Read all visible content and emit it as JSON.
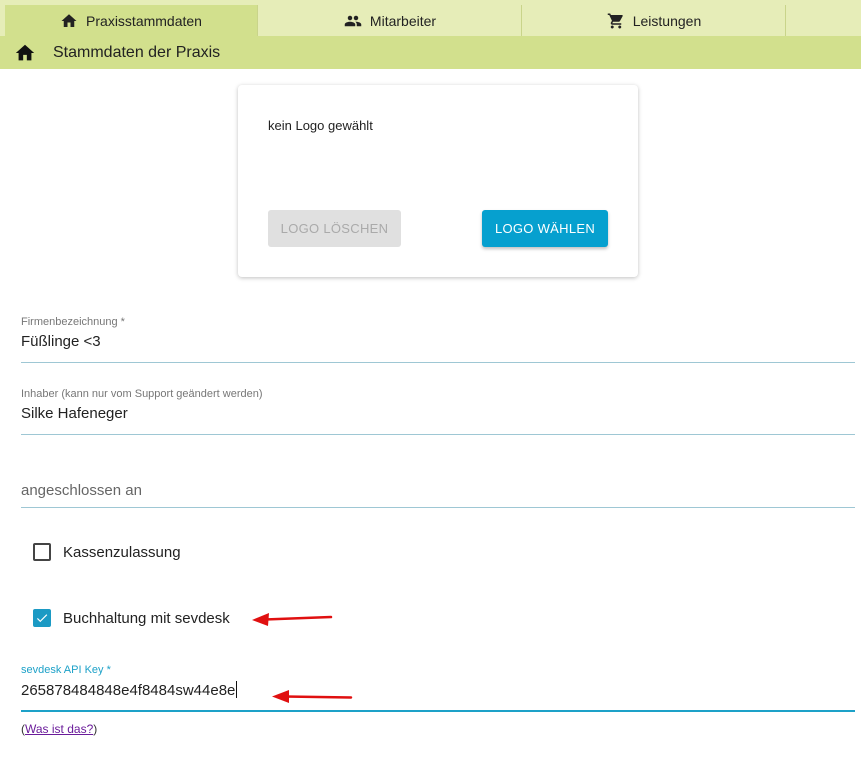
{
  "tabs": [
    {
      "label": "Praxisstammdaten",
      "icon": "home-icon",
      "active": true
    },
    {
      "label": "Mitarbeiter",
      "icon": "people-icon",
      "active": false
    },
    {
      "label": "Leistungen",
      "icon": "cart-icon",
      "active": false
    }
  ],
  "header": {
    "title": "Stammdaten der Praxis",
    "icon": "home-icon"
  },
  "logo": {
    "status": "kein Logo gewählt",
    "delete_label": "LOGO LÖSCHEN",
    "choose_label": "LOGO WÄHLEN"
  },
  "form": {
    "firma": {
      "label": "Firmenbezeichnung *",
      "value": "Füßlinge <3"
    },
    "inhaber": {
      "label": "Inhaber (kann nur vom Support geändert werden)",
      "value": "Silke Hafeneger"
    },
    "angeschlossen": {
      "placeholder": "angeschlossen an"
    },
    "kasse": {
      "label": "Kassenzulassung",
      "checked": false
    },
    "sevdesk": {
      "label": "Buchhaltung mit sevdesk",
      "checked": true
    },
    "api_key": {
      "label": "sevdesk API Key *",
      "value": "265878484848e4f8484sw44e8e"
    }
  },
  "help": {
    "prefix": "(",
    "link": "Was ist das?",
    "suffix": ")"
  },
  "colors": {
    "accent": "#06a0cf",
    "tabbar": "#e6edb8",
    "header": "#d2e08d",
    "annotation": "#e01010"
  }
}
